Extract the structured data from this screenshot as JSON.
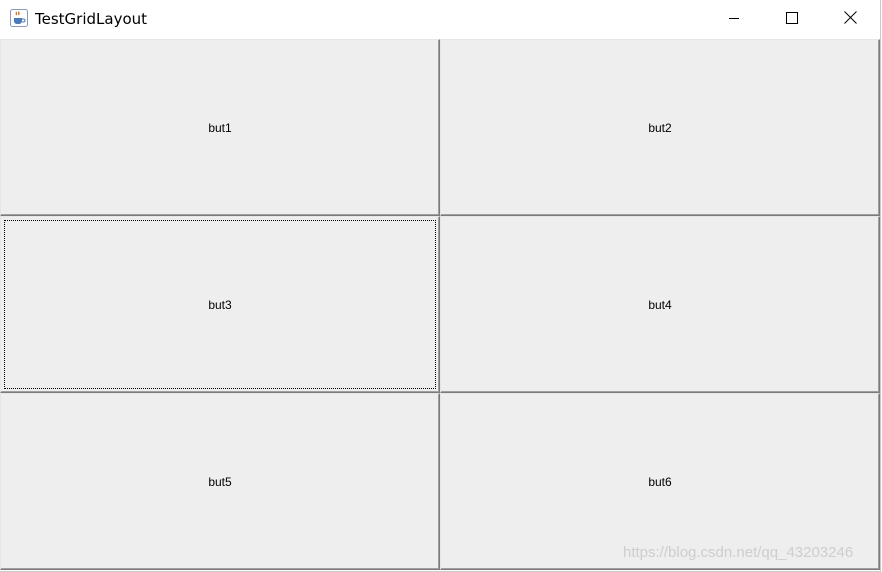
{
  "window": {
    "title": "TestGridLayout",
    "app_icon": "java-coffee-icon",
    "controls": {
      "minimize_icon": "minimize-icon",
      "maximize_icon": "maximize-icon",
      "close_icon": "close-icon"
    }
  },
  "grid": {
    "rows": 3,
    "columns": 2,
    "buttons": [
      {
        "label": "but1",
        "focused": false
      },
      {
        "label": "but2",
        "focused": false
      },
      {
        "label": "but3",
        "focused": true
      },
      {
        "label": "but4",
        "focused": false
      },
      {
        "label": "but5",
        "focused": false
      },
      {
        "label": "but6",
        "focused": false
      }
    ]
  },
  "watermark": "https://blog.csdn.net/qq_43203246",
  "colors": {
    "button_face": "#eeeeee",
    "button_border": "#7a7a7a"
  }
}
